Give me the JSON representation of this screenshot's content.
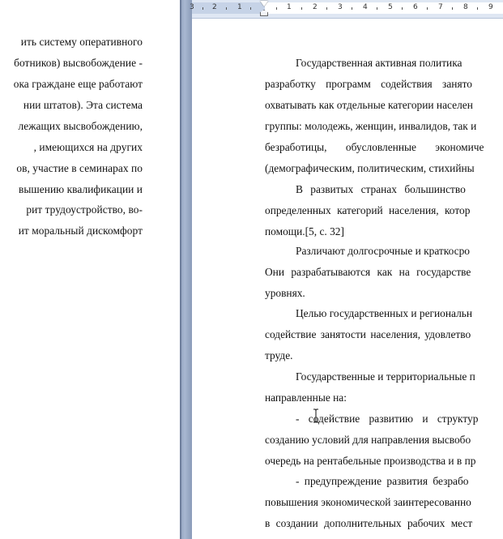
{
  "left_page": {
    "lines": [
      "ить систему оперативного",
      "ботников) высвобождение -",
      "ока граждане еще работают",
      "нии штатов). Эта система",
      "лежащих высвобождению,",
      ", имеющихся на других",
      "ов, участие в семинарах по",
      "вышению квалификации и",
      "рит трудоустройство, во-",
      "ит моральный дискомфорт"
    ]
  },
  "ruler": {
    "labels": [
      "3",
      "2",
      "1",
      "1",
      "2",
      "3",
      "4",
      "5",
      "6",
      "7",
      "8",
      "9"
    ]
  },
  "right_page": {
    "lines": [
      "Государственная активная политика",
      "разработку программ содействия занято",
      "охватывать как отдельные категории населен",
      "группы: молодежь, женщин, инвалидов, так и",
      "безработицы, обусловленные экономиче",
      "(демографическим, политическим, стихийны",
      "В развитых странах большинство",
      "определенных категорий населения, котор",
      "помощи.[5, с. 32]",
      "Различают долгосрочные и краткосро",
      "Они разрабатываются как на государстве",
      "уровнях.",
      "Целью государственных и региональн",
      "содействие занятости населения, удовлетво",
      "труде.",
      "Государственные и территориальные п",
      "направленные на:",
      "- содействие развитию и структур",
      "созданию условий для направления высвобо",
      "очередь на рентабельные производства и в пр",
      "- предупреждение развития безрабо",
      "повышения экономической заинтересованно",
      "в создании дополнительных рабочих мест"
    ]
  },
  "cursor": {
    "icon": "i-beam-cursor-icon"
  }
}
